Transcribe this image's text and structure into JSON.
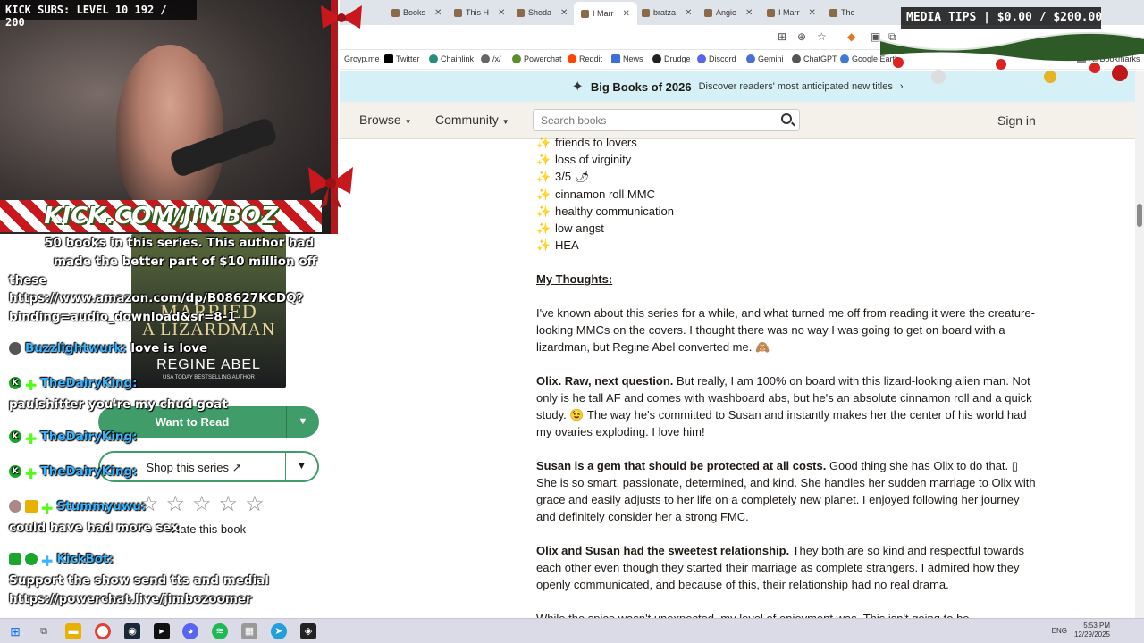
{
  "browser": {
    "tabs": [
      {
        "label": "Books"
      },
      {
        "label": "This H"
      },
      {
        "label": "Shoda"
      },
      {
        "label": "I Marr"
      },
      {
        "label": "bratza"
      },
      {
        "label": "Angie"
      },
      {
        "label": "I Marr"
      },
      {
        "label": "The"
      }
    ],
    "bookmarks": [
      "Groyp.me",
      "Twitter",
      "Chainlink",
      "/x/",
      "Powerchat",
      "Reddit",
      "News",
      "Drudge",
      "Discord",
      "Gemini",
      "ChatGPT",
      "Google Earth",
      "All Bookmarks"
    ]
  },
  "promo": {
    "title": "Big Books of 2026",
    "subtitle": "Discover readers' most anticipated new titles",
    "arrow": "›"
  },
  "nav": {
    "browse": "Browse",
    "community": "Community",
    "search_placeholder": "Search books",
    "signin": "Sign in"
  },
  "review": {
    "tags": [
      "friends to lovers",
      "loss of virginity",
      "3/5 🌶",
      "cinnamon roll MMC",
      "healthy communication",
      "low angst",
      "HEA"
    ],
    "thoughts_heading": "My Thoughts:",
    "p1": "I've known about this series for a while, and what turned me off from reading it were the creature-looking MMCs on the covers. I thought there was no way I was going to get on board with a lizardman, but Regine Abel converted me. 🙈",
    "p2_bold": "Olix. Raw, next question.",
    "p2": " But really, I am 100% on board with this lizard-looking alien man. Not only is he tall AF and comes with washboard abs, but he's an absolute cinnamon roll and a quick study. 😉 The way he's committed to Susan and instantly makes her the center of his world had my ovaries exploding. I love him!",
    "p3_bold": "Susan is a gem that should be protected at all costs.",
    "p3": " Good thing she has Olix to do that. ▯ She is so smart, passionate, determined, and kind. She handles her sudden marriage to Olix with grace and easily adjusts to her life on a completely new planet. I enjoyed following her journey and definitely consider her a strong FMC.",
    "p4_bold": "Olix and Susan had the sweetest relationship.",
    "p4": " They both are so kind and respectful towards each other even though they started their marriage as complete strangers. I admired how they openly communicated, and because of this, their relationship had no real drama.",
    "p5": "While the spice wasn't unexpected, my level of enjoyment was. This isn't going to be"
  },
  "book": {
    "cover_line1": "MARRIED",
    "cover_line2": "A LIZARDMAN",
    "cover_author": "REGINE ABEL",
    "cover_tagline": "USA TODAY BESTSELLING AUTHOR",
    "want_label": "Want to Read",
    "shop_label": "Shop this series",
    "rate_label": "Rate this book",
    "stars": "☆☆☆☆☆"
  },
  "stream": {
    "subs": "KICK SUBS: LEVEL 10 192 / 200",
    "url": "KICK.COM/JIMBOZ",
    "media": "MEDIA TIPS | $0.00 / $200.00",
    "chat": {
      "l1": "50 books in this series. This author had",
      "l2": "made the better part of $10 million off",
      "l3": "these",
      "l4": "https://www.amazon.com/dp/B08627KCDQ?",
      "l5": "binding=audio_download&sr=8-1",
      "l6_user": "Buzzlightwurk:",
      "l6_msg": "love is love",
      "l7_user": "TheDairyKing:",
      "l8": "paulshitter you're my chud goat",
      "l9_user": "TheDairyKing:",
      "l10_user": "TheDairyKing:",
      "l11_user": "Stummyuwu:",
      "l12": "could have had more sex",
      "l13_user": "KickBot:",
      "l14": "Support the show send tts and medial",
      "l15": "https://powerchat.live/jimbozoomer"
    }
  },
  "taskbar": {
    "lang": "ENG",
    "time": "5:53 PM",
    "date": "12/29/2025"
  },
  "colors": {
    "goodreads_green": "#409d69",
    "promo_bg": "#d5f1f7",
    "nav_bg": "#f4f1ea",
    "chat_user": "#39b5ff"
  }
}
